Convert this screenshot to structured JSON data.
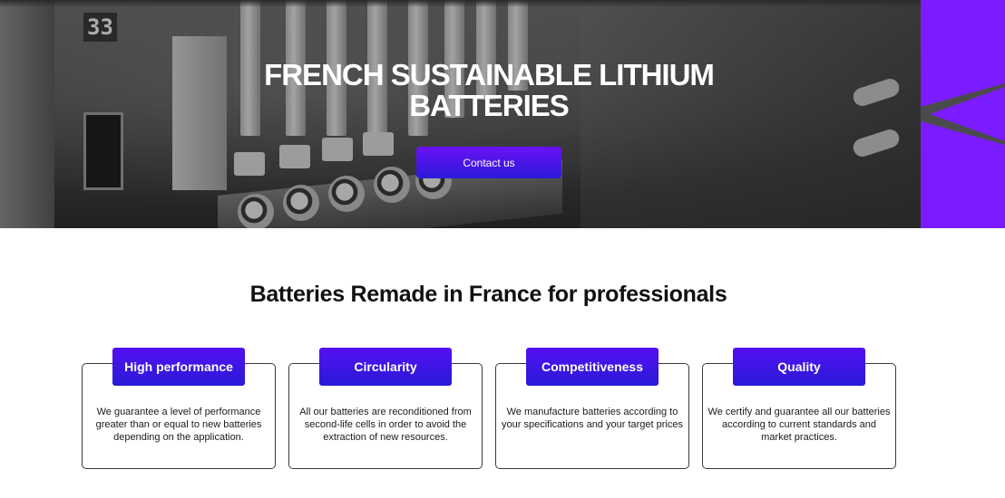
{
  "hero": {
    "title": "FRENCH SUSTAINABLE LITHIUM BATTERIES",
    "cta_label": "Contact us",
    "photo_digits": "33"
  },
  "colors": {
    "accent": "#7a1cff",
    "button_top": "#6a12f5",
    "button_bottom": "#2b1ad8"
  },
  "section": {
    "title": "Batteries Remade in France for professionals"
  },
  "features": [
    {
      "label": "High performance",
      "text": "We guarantee a level of performance greater than or equal to new batteries depending on the application."
    },
    {
      "label": "Circularity",
      "text": "All our batteries are reconditioned from second-life cells in order to avoid the extraction of new resources."
    },
    {
      "label": "Competitiveness",
      "text": "We manufacture batteries according to your specifications and your target prices"
    },
    {
      "label": "Quality",
      "text": "We certify and guarantee all our batteries according to current standards and market practices."
    }
  ]
}
